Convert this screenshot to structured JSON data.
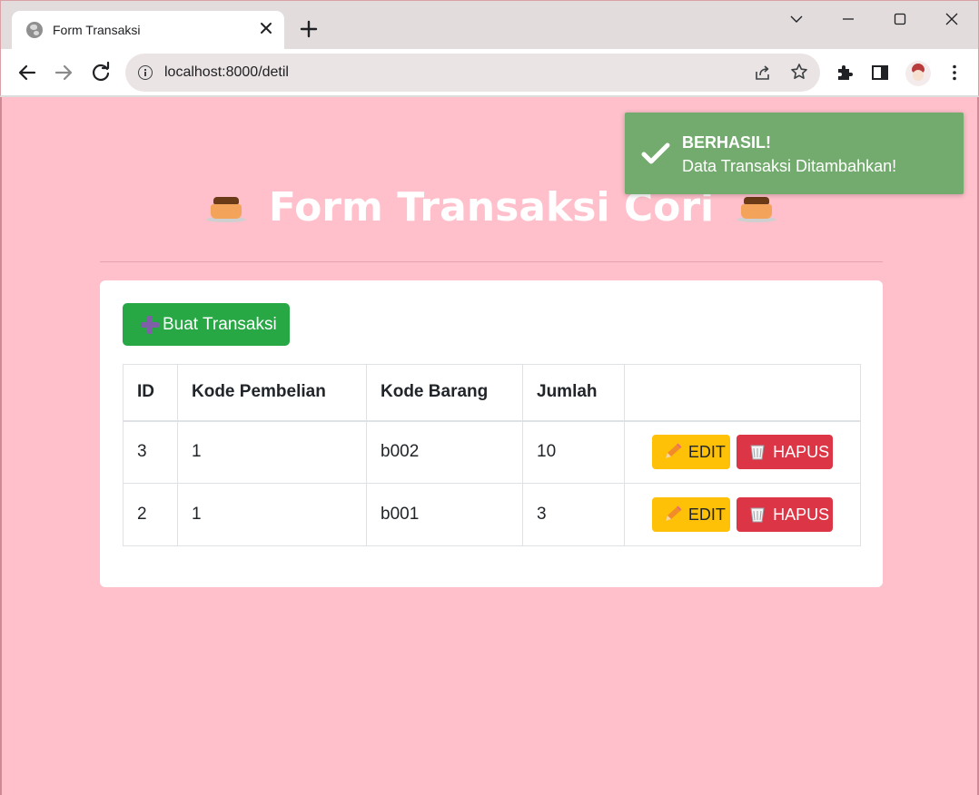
{
  "browser": {
    "tab_title": "Form Transaksi",
    "url": "localhost:8000/detil"
  },
  "page": {
    "heading": "Form Transaksi Cori",
    "create_button": "Buat Transaksi",
    "table": {
      "headers": [
        "ID",
        "Kode Pembelian",
        "Kode Barang",
        "Jumlah",
        ""
      ],
      "rows": [
        {
          "id": "3",
          "kode_pembelian": "1",
          "kode_barang": "b002",
          "jumlah": "10"
        },
        {
          "id": "2",
          "kode_pembelian": "1",
          "kode_barang": "b001",
          "jumlah": "3"
        }
      ],
      "edit_label": "EDIT",
      "delete_label": "HAPUS"
    }
  },
  "toast": {
    "title": "BERHASIL!",
    "message": "Data Transaksi Ditambahkan!"
  },
  "colors": {
    "page_background": "#ffc0cb",
    "create_button": "#28a745",
    "edit_button": "#ffc107",
    "delete_button": "#dc3545",
    "toast_background": "#73ab6e"
  },
  "icons": [
    "globe-icon",
    "close-icon",
    "plus-icon",
    "chevron-down-icon",
    "minimize-icon",
    "maximize-icon",
    "window-close-icon",
    "back-arrow-icon",
    "forward-arrow-icon",
    "reload-icon",
    "info-icon",
    "share-icon",
    "star-icon",
    "extensions-icon",
    "side-panel-icon",
    "avatar",
    "kebab-menu-icon",
    "flan-icon",
    "pencil-icon",
    "wastebasket-icon",
    "check-icon"
  ]
}
